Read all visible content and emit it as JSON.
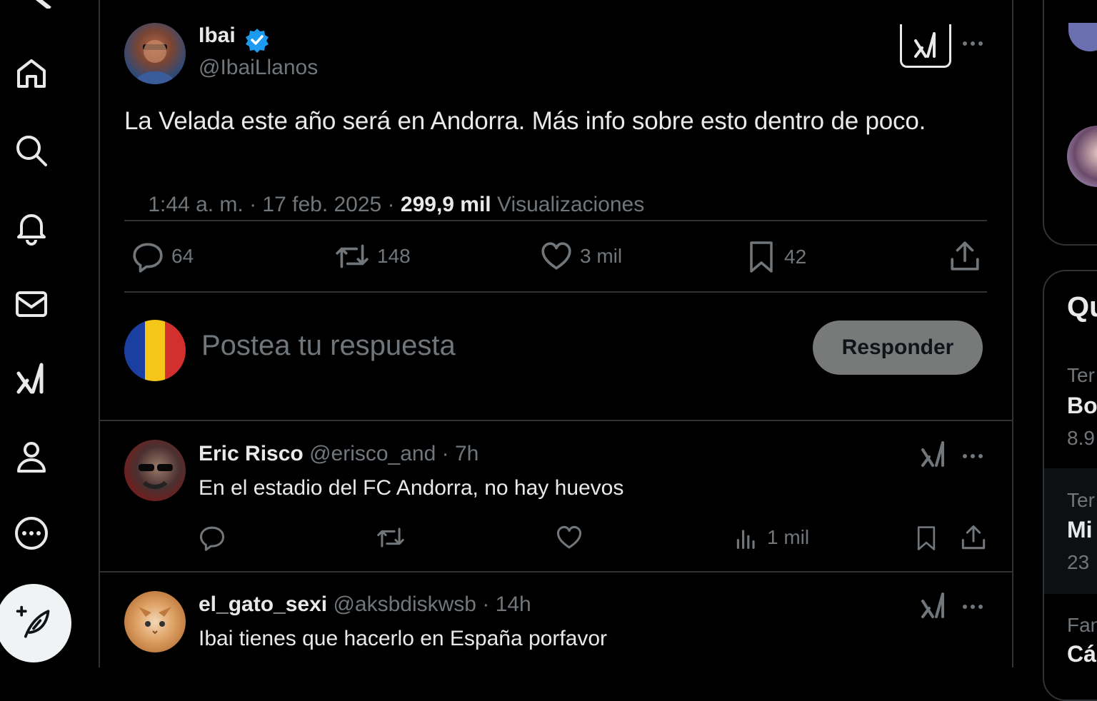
{
  "nav": {
    "items": [
      {
        "name": "home",
        "icon": "home-icon"
      },
      {
        "name": "explore",
        "icon": "search-icon"
      },
      {
        "name": "notifications",
        "icon": "bell-icon"
      },
      {
        "name": "messages",
        "icon": "mail-icon"
      },
      {
        "name": "grok",
        "icon": "grok-icon"
      },
      {
        "name": "profile",
        "icon": "person-icon"
      },
      {
        "name": "more",
        "icon": "more-circle-icon"
      }
    ],
    "post_icon": "feather-plus-icon"
  },
  "tweet": {
    "author_name": "Ibai",
    "author_handle": "@IbaiLlanos",
    "verified": true,
    "text": "La Velada este año será en Andorra. Más info sobre esto dentro de poco.",
    "time": "1:44 a. m. · 17 feb. 2025 · ",
    "views_count": "299,9 mil",
    "views_label": " Visualizaciones",
    "stats": {
      "replies": "64",
      "retweets": "148",
      "likes": "3 mil",
      "bookmarks": "42"
    }
  },
  "composer": {
    "placeholder": "Postea tu respuesta",
    "button": "Responder"
  },
  "replies": [
    {
      "name": "Eric Risco",
      "handle": "@erisco_and",
      "time": "· 7h",
      "text": "En el estadio del FC Andorra, no hay huevos",
      "views": "1 mil"
    },
    {
      "name": "el_gato_sexi",
      "handle": "@aksbdiskwsb",
      "time": "· 14h",
      "text": "Ibai tienes que hacerlo en España porfavor"
    }
  ],
  "sidebar_right": {
    "heading": "Qu",
    "trends": [
      {
        "category": "Ter",
        "title": "Bo",
        "count": "8.9"
      },
      {
        "category": "Ter",
        "title": "Mi",
        "count": "23"
      },
      {
        "category": "Fan",
        "title": "Cá"
      }
    ]
  },
  "colors": {
    "background": "#000000",
    "border": "#2f3336",
    "muted": "#71767b",
    "verified": "#1d9bf0",
    "reply_button": "#787a7a"
  }
}
